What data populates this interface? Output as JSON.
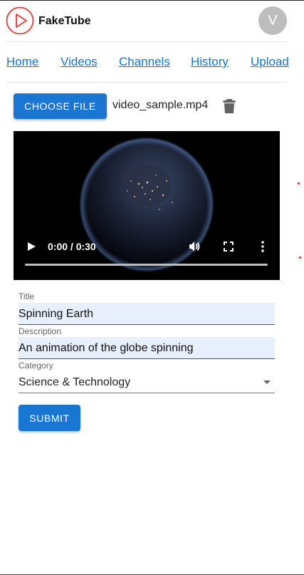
{
  "app": {
    "brand": "FakeTube",
    "avatar_letter": "V"
  },
  "nav": {
    "items": [
      "Home",
      "Videos",
      "Channels",
      "History",
      "Upload"
    ]
  },
  "upload": {
    "choose_label": "CHOOSE FILE",
    "file_name": "video_sample.mp4",
    "delete_icon": "trash-icon"
  },
  "player": {
    "time": "0:00 / 0:30",
    "progress": 0
  },
  "form": {
    "title_label": "Title",
    "title_value": "Spinning Earth",
    "description_label": "Description",
    "description_value": "An animation of the globe spinning",
    "category_label": "Category",
    "category_value": "Science & Technology",
    "submit_label": "SUBMIT"
  },
  "colors": {
    "primary": "#1976d2",
    "link": "#1a73c8",
    "logo_red": "#e53935",
    "avatar": "#bdbdbd",
    "input_fill": "#e8f0fe"
  }
}
